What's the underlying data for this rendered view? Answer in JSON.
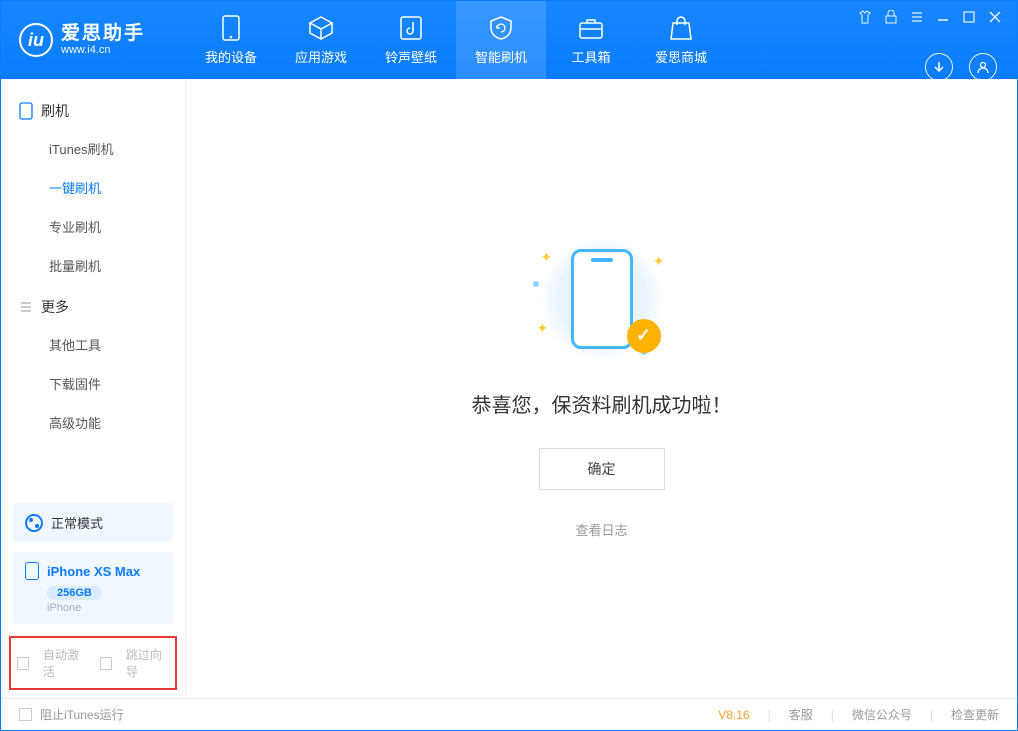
{
  "app": {
    "name": "爱思助手",
    "url": "www.i4.cn"
  },
  "tabs": {
    "device": "我的设备",
    "apps": "应用游戏",
    "ringtone": "铃声壁纸",
    "flash": "智能刷机",
    "toolbox": "工具箱",
    "store": "爱思商城"
  },
  "sidebar": {
    "section_flash": "刷机",
    "items_flash": {
      "itunes": "iTunes刷机",
      "onekey": "一键刷机",
      "pro": "专业刷机",
      "batch": "批量刷机"
    },
    "section_more": "更多",
    "items_more": {
      "other": "其他工具",
      "firmware": "下载固件",
      "advanced": "高级功能"
    },
    "mode": "正常模式",
    "device": {
      "name": "iPhone XS Max",
      "storage": "256GB",
      "type": "iPhone"
    },
    "opts": {
      "auto_activate": "自动激活",
      "skip_guide": "跳过向导"
    }
  },
  "main": {
    "success": "恭喜您，保资料刷机成功啦！",
    "ok": "确定",
    "view_log": "查看日志"
  },
  "status": {
    "block_itunes": "阻止iTunes运行",
    "version": "V8.16",
    "support": "客服",
    "wechat": "微信公众号",
    "update": "检查更新"
  }
}
